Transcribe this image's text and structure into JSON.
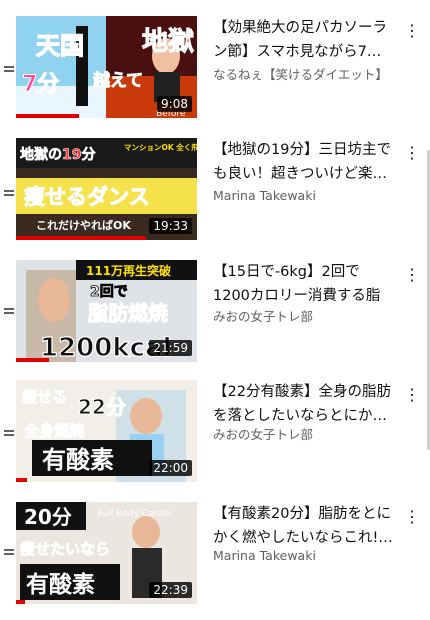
{
  "videos": [
    {
      "title": "【効果絶大の足パカソーラン節】スマホ見ながら7…",
      "channel": "なるねぇ【笑けるダイエット】",
      "duration": "9:08",
      "thumb_text": [
        "天国",
        "7分",
        "越えて",
        "地獄",
        "Before"
      ],
      "progress": 0.35
    },
    {
      "title": "【地獄の19分】三日坊主でも良い！超きついけど楽…",
      "channel": "Marina Takewaki",
      "duration": "19:33",
      "thumb_text": [
        "地獄の19分",
        "マンションOK 全く飛ばない！",
        "痩せるダンス",
        "これだけやればOK"
      ],
      "progress": 0.72
    },
    {
      "title": "【15日で-6kg】2回で1200カロリー消費する脂肪燃…",
      "channel": "みおの女子トレ部",
      "duration": "21:59",
      "thumb_text": [
        "111万再生突破",
        "2回で",
        "脂肪燃焼",
        "1200kcal"
      ],
      "progress": 0.18
    },
    {
      "title": "【22分有酸素】全身の脂肪を落としたいならとにか…",
      "channel": "みおの女子トレ部",
      "duration": "22:00",
      "thumb_text": [
        "痩せる",
        "22分",
        "全身燃焼",
        "有酸素"
      ],
      "progress": 0.06
    },
    {
      "title": "【有酸素20分】脂肪をとにかく燃やしたいならこれ!…",
      "channel": "Marina Takewaki",
      "duration": "22:39",
      "thumb_text": [
        "Full Body Cardio",
        "20分",
        "痩せたいなら",
        "有酸素"
      ],
      "progress": 0.05
    }
  ],
  "icons": {
    "drag": "drag-handle-icon",
    "menu": "more-vert-icon"
  },
  "colors": {
    "progress": "#e00000",
    "secondary_text": "#606060"
  }
}
